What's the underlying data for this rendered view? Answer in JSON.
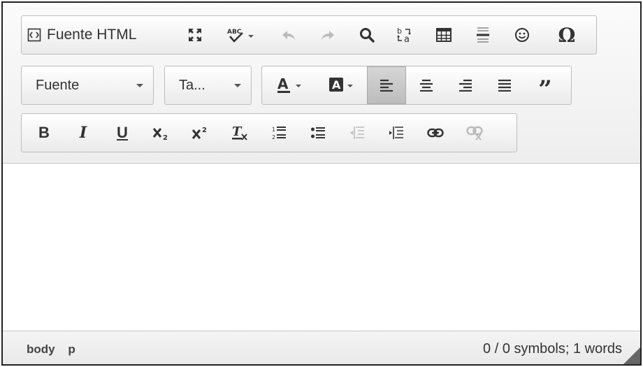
{
  "toolbar": {
    "row1": {
      "source_label": "Fuente HTML",
      "buttons": [
        "maximize-icon",
        "spellcheck-icon",
        "undo-icon",
        "redo-icon",
        "find-icon",
        "replace-icon",
        "table-icon",
        "horizontal-rule-icon",
        "smiley-icon",
        "special-char-icon"
      ]
    },
    "row2": {
      "font_combo": "Fuente",
      "size_combo": "Ta...",
      "buttons": [
        "text-color-icon",
        "background-color-icon",
        "align-left-icon",
        "align-center-icon",
        "align-right-icon",
        "justify-icon",
        "blockquote-icon"
      ],
      "active": "align-left-icon"
    },
    "row3": {
      "bold": "B",
      "italic": "I",
      "underline": "U",
      "buttons": [
        "subscript-icon",
        "superscript-icon",
        "remove-format-icon",
        "numbered-list-icon",
        "bulleted-list-icon",
        "outdent-icon",
        "indent-icon",
        "link-icon",
        "unlink-icon"
      ]
    }
  },
  "status": {
    "path": [
      "body",
      "p"
    ],
    "word_count": "0 / 0 symbols; 1 words"
  },
  "colors": {
    "active_button": "#c2c2c2",
    "disabled_icon": "#b8b8b8"
  }
}
